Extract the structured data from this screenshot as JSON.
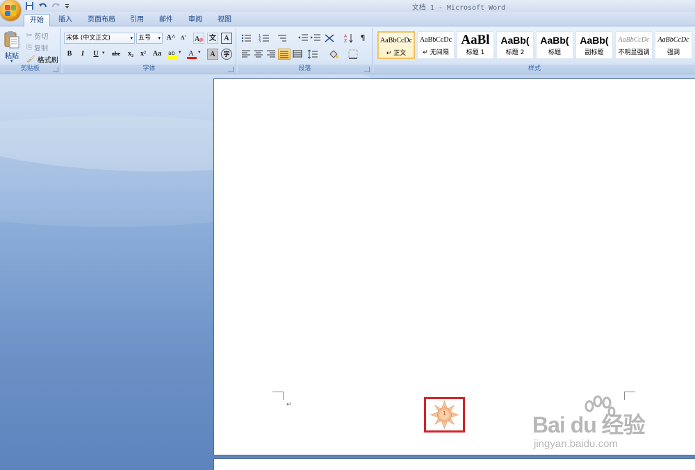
{
  "window": {
    "title": "文档 1 - Microsoft Word"
  },
  "qat": [
    {
      "icon": "save-icon"
    },
    {
      "icon": "undo-icon"
    },
    {
      "icon": "redo-icon"
    },
    {
      "icon": "customize-icon"
    }
  ],
  "tabs": [
    {
      "label": "开始",
      "active": true
    },
    {
      "label": "插入"
    },
    {
      "label": "页面布局"
    },
    {
      "label": "引用"
    },
    {
      "label": "邮件"
    },
    {
      "label": "审阅"
    },
    {
      "label": "视图"
    }
  ],
  "clipboard": {
    "paste": "粘贴",
    "cut": "剪切",
    "copy": "复制",
    "format_painter": "格式刷",
    "group": "剪贴板"
  },
  "font": {
    "name": "宋体 (中文正文)",
    "size": "五号",
    "group": "字体",
    "buttons": {
      "bold": "B",
      "italic": "I",
      "underline": "U",
      "strike": "abe",
      "sub": "x₂",
      "sup": "x²",
      "case": "Aa",
      "grow": "A^",
      "shrink": "Aˇ",
      "clear": "A",
      "pinyin": "文",
      "border": "A",
      "char_shading": "A",
      "enclose": "字"
    }
  },
  "paragraph": {
    "group": "段落"
  },
  "styles": {
    "group": "样式",
    "items": [
      {
        "sample": "AaBbCcDc",
        "name": "↵ 正文",
        "selected": true
      },
      {
        "sample": "AaBbCcDc",
        "name": "↵ 无间隔"
      },
      {
        "sample": "AaBl",
        "name": "标题 1"
      },
      {
        "sample": "AaBb(",
        "name": "标题 2"
      },
      {
        "sample": "AaBb(",
        "name": "标题"
      },
      {
        "sample": "AaBb(",
        "name": "副标题"
      },
      {
        "sample": "AaBbCcDc",
        "name": "不明显强调"
      },
      {
        "sample": "AaBbCcDc",
        "name": "强调"
      }
    ]
  },
  "document": {
    "paragraph_mark": "↵",
    "page_number": "1"
  },
  "watermark": {
    "brand": "Bai du 经验",
    "url": "jingyan.baidu.com"
  },
  "colors": {
    "highlight": "#ffff00",
    "font_color": "#ff0000",
    "selection_box": "#d2232a"
  }
}
